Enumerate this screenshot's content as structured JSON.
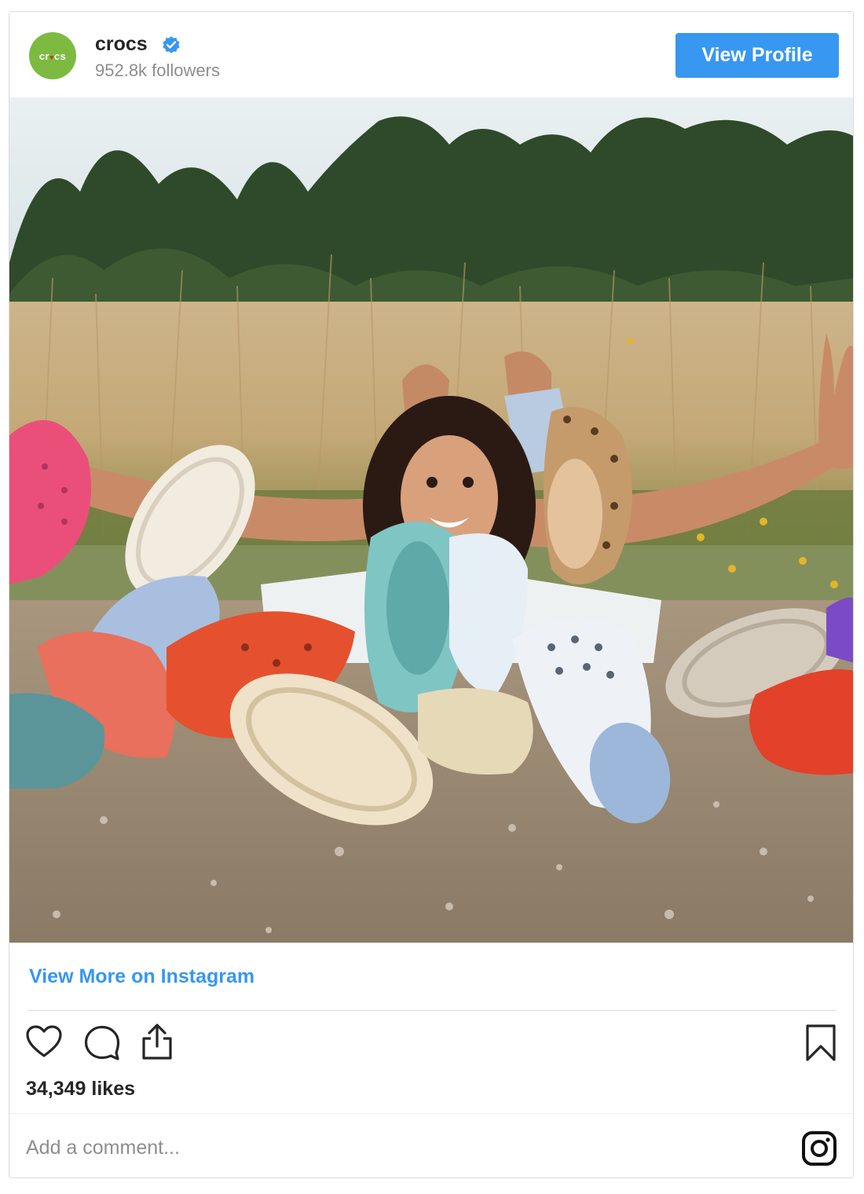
{
  "header": {
    "account_name": "crocs",
    "avatar_text": "cr",
    "avatar_text_end": "cs",
    "followers": "952.8k followers",
    "view_profile_label": "View Profile",
    "verified": true
  },
  "post": {
    "image_alt": "Photo of a person lying in grass behind a pile of colorful clogs"
  },
  "footer": {
    "view_more_label": "View More on Instagram",
    "likes": "34,349 likes",
    "comment_placeholder": "Add a comment..."
  },
  "icons": {
    "like": "heart-icon",
    "comment": "comment-icon",
    "share": "share-icon",
    "save": "bookmark-icon",
    "brand": "instagram-icon"
  },
  "colors": {
    "accent": "#3897f0",
    "verified": "#3897f0",
    "avatar_bg": "#7cbb3f",
    "muted_text": "#8e8e8e"
  }
}
